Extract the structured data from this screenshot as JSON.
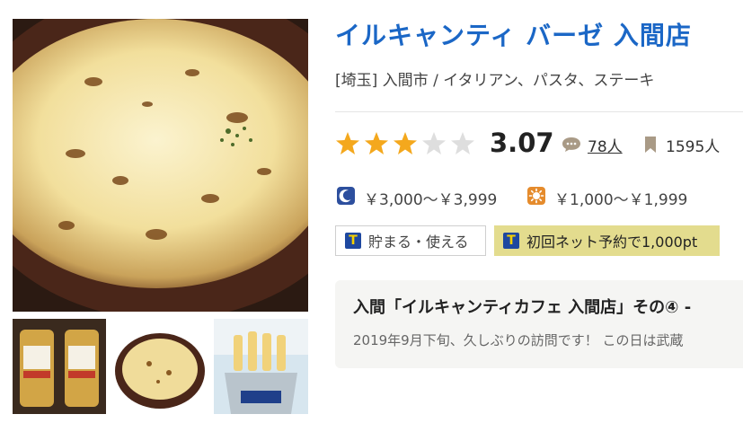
{
  "restaurant": {
    "name": "イルキャンティ バーゼ 入間店",
    "area_genre": "[埼玉] 入間市 / イタリアン、パスタ、ステーキ"
  },
  "rating": {
    "score": "3.07",
    "stars_filled": 3,
    "stars_total": 5,
    "review_count": "78人",
    "bookmark_count": "1595人"
  },
  "prices": {
    "dinner": "￥3,000～￥3,999",
    "lunch": "￥1,000～￥1,999"
  },
  "badges": {
    "tpoint": "貯まる・使える",
    "tpoint_icon_text": "T",
    "net_reservation": "初回ネット予約で1,000pt"
  },
  "review": {
    "title": "入間「イルキャンティカフェ 入間店」その④ -",
    "snippet": "2019年9月下旬、久しぶりの訪問です！ この日は武蔵"
  },
  "colors": {
    "title": "#1b67c6",
    "star_filled": "#f4a81d",
    "star_empty": "#dedede",
    "badge_bg": "#e3dc8e"
  },
  "icons": {
    "review": "speech-bubble-icon",
    "bookmark": "bookmark-icon",
    "dinner": "moon-icon",
    "lunch": "sun-icon"
  }
}
